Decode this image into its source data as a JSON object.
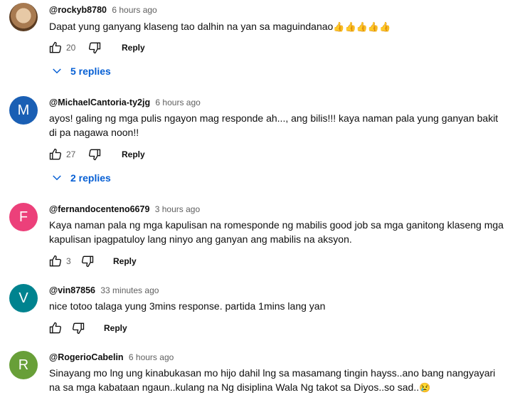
{
  "comments": [
    {
      "author": "@rockyb8780",
      "time": "6 hours ago",
      "text": "Dapat yung ganyang klaseng tao dalhin na yan sa maguindanao",
      "emoji": "👍👍👍👍👍",
      "likes": "20",
      "reply_label": "Reply",
      "replies_label": "5 replies"
    },
    {
      "author": "@MichaelCantoria-ty2jg",
      "time": "6 hours ago",
      "avatar_letter": "M",
      "avatar_color": "#1a5fb4",
      "text": "ayos! galing ng mga pulis ngayon mag responde ah..., ang bilis!!! kaya naman pala yung ganyan bakit di pa nagawa noon!!",
      "likes": "27",
      "reply_label": "Reply",
      "replies_label": "2 replies"
    },
    {
      "author": "@fernandocenteno6679",
      "time": "3 hours ago",
      "avatar_letter": "F",
      "avatar_color": "#ec407a",
      "text": "Kaya naman pala ng mga kapulisan na romesponde ng mabilis good job sa mga ganitong klaseng mga kapulisan ipagpatuloy lang ninyo ang ganyan ang mabilis na aksyon.",
      "likes": "3",
      "reply_label": "Reply"
    },
    {
      "author": "@vin87856",
      "time": "33 minutes ago",
      "avatar_letter": "V",
      "avatar_color": "#00838f",
      "text": "nice totoo talaga yung 3mins response. partida 1mins lang yan",
      "reply_label": "Reply"
    },
    {
      "author": "@RogerioCabelin",
      "time": "6 hours ago",
      "avatar_letter": "R",
      "avatar_color": "#689f38",
      "text": "Sinayang mo lng ung kinabukasan mo hijo dahil lng sa masamang tingin hayss..ano bang nangyayari na sa mga kabataan ngaun..kulang na Ng disiplina Wala Ng takot sa Diyos..so sad..",
      "emoji": "😢"
    }
  ]
}
